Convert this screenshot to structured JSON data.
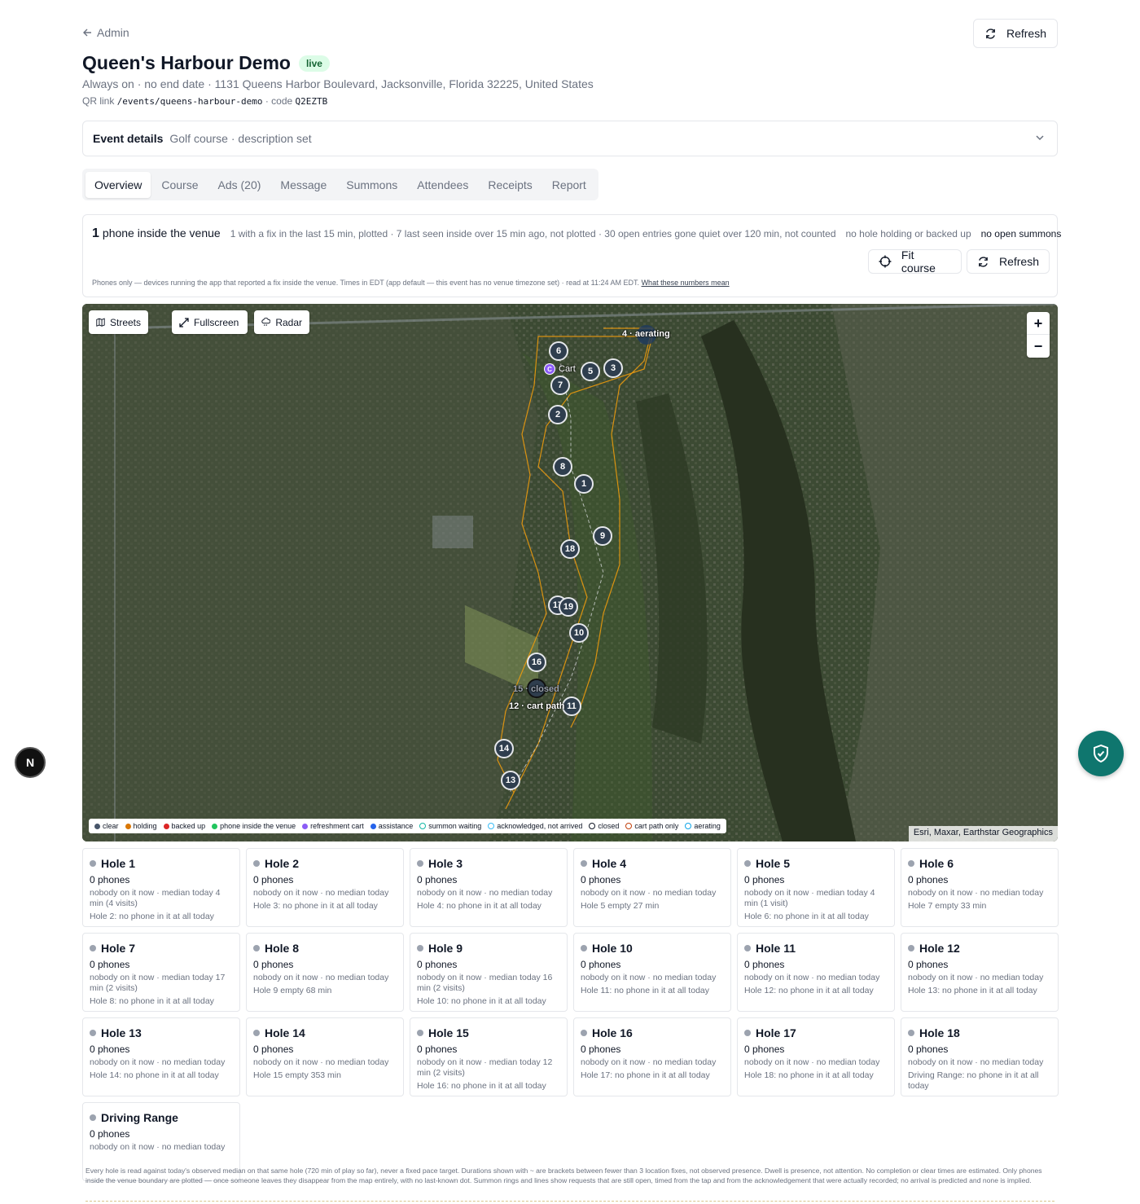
{
  "header": {
    "back_label": "Admin",
    "refresh_label": "Refresh",
    "title": "Queen's Harbour Demo",
    "live_badge": "live",
    "subline": "Always on · no end date · 1131 Queens Harbor Boulevard, Jacksonville, Florida 32225, United States",
    "qr_label": "QR link",
    "qr_path": "/events/queens-harbour-demo",
    "code_label": "· code",
    "code": "Q2EZTB"
  },
  "event_details": {
    "label": "Event details",
    "summary": "Golf course · description set"
  },
  "tabs": [
    {
      "label": "Overview",
      "active": true
    },
    {
      "label": "Course"
    },
    {
      "label": "Ads (20)"
    },
    {
      "label": "Message"
    },
    {
      "label": "Summons"
    },
    {
      "label": "Attendees"
    },
    {
      "label": "Receipts"
    },
    {
      "label": "Report"
    }
  ],
  "summary": {
    "count": "1",
    "count_label": "phone inside the venue",
    "detail": "1 with a fix in the last 15 min, plotted · 7 last seen inside over 15 min ago, not plotted · 30 open entries gone quiet over 120 min, not counted",
    "holding": "no hole holding or backed up",
    "summons": "no open summons",
    "fit_label": "Fit course",
    "refresh_label": "Refresh",
    "note": "Phones only — devices running the app that reported a fix inside the venue. Times in EDT (app default — this event has no venue timezone set) · read at 11:24 AM EDT.",
    "note_link": "What these numbers mean"
  },
  "map": {
    "streets_label": "Streets",
    "fullscreen_label": "Fullscreen",
    "radar_label": "Radar",
    "zoom_in": "+",
    "zoom_out": "−",
    "attribution": "Esri, Maxar, Earthstar Geographics",
    "labels": {
      "aerating": "4 · aerating",
      "cart": "Cart",
      "closed": "15 · closed",
      "cart_path": "12 · cart path"
    },
    "markers": [
      "6",
      "5",
      "3",
      "7",
      "2",
      "8",
      "1",
      "9",
      "18",
      "17",
      "19",
      "10",
      "16",
      "11",
      "14",
      "13"
    ],
    "cart_marker": "C",
    "legend": [
      {
        "label": "clear",
        "color": "#475569",
        "kind": "dot"
      },
      {
        "label": "holding",
        "color": "#d97706",
        "kind": "dot"
      },
      {
        "label": "backed up",
        "color": "#dc2626",
        "kind": "dot"
      },
      {
        "label": "phone inside the venue",
        "color": "#22c55e",
        "kind": "dot"
      },
      {
        "label": "refreshment cart",
        "color": "#8b5cf6",
        "kind": "dot"
      },
      {
        "label": "assistance",
        "color": "#2563eb",
        "kind": "dot"
      },
      {
        "label": "summon waiting",
        "color": "#14b8a6",
        "kind": "ring"
      },
      {
        "label": "acknowledged, not arrived",
        "color": "#38bdf8",
        "kind": "ring"
      },
      {
        "label": "closed",
        "color": "#111827",
        "kind": "ring"
      },
      {
        "label": "cart path only",
        "color": "#c2410c",
        "kind": "ring"
      },
      {
        "label": "aerating",
        "color": "#0ea5e9",
        "kind": "ring"
      }
    ]
  },
  "holes": [
    {
      "name": "Hole 1",
      "phones": "0 phones",
      "info": "nobody on it now · median today 4 min (4 visits)",
      "next": "Hole 2: no phone in it at all today"
    },
    {
      "name": "Hole 2",
      "phones": "0 phones",
      "info": "nobody on it now · no median today",
      "next": "Hole 3: no phone in it at all today"
    },
    {
      "name": "Hole 3",
      "phones": "0 phones",
      "info": "nobody on it now · no median today",
      "next": "Hole 4: no phone in it at all today"
    },
    {
      "name": "Hole 4",
      "phones": "0 phones",
      "info": "nobody on it now · no median today",
      "next": "Hole 5 empty 27 min"
    },
    {
      "name": "Hole 5",
      "phones": "0 phones",
      "info": "nobody on it now · median today 4 min (1 visit)",
      "next": "Hole 6: no phone in it at all today"
    },
    {
      "name": "Hole 6",
      "phones": "0 phones",
      "info": "nobody on it now · no median today",
      "next": "Hole 7 empty 33 min"
    },
    {
      "name": "Hole 7",
      "phones": "0 phones",
      "info": "nobody on it now · median today 17 min (2 visits)",
      "next": "Hole 8: no phone in it at all today"
    },
    {
      "name": "Hole 8",
      "phones": "0 phones",
      "info": "nobody on it now · no median today",
      "next": "Hole 9 empty 68 min"
    },
    {
      "name": "Hole 9",
      "phones": "0 phones",
      "info": "nobody on it now · median today 16 min (2 visits)",
      "next": "Hole 10: no phone in it at all today"
    },
    {
      "name": "Hole 10",
      "phones": "0 phones",
      "info": "nobody on it now · no median today",
      "next": "Hole 11: no phone in it at all today"
    },
    {
      "name": "Hole 11",
      "phones": "0 phones",
      "info": "nobody on it now · no median today",
      "next": "Hole 12: no phone in it at all today"
    },
    {
      "name": "Hole 12",
      "phones": "0 phones",
      "info": "nobody on it now · no median today",
      "next": "Hole 13: no phone in it at all today"
    },
    {
      "name": "Hole 13",
      "phones": "0 phones",
      "info": "nobody on it now · no median today",
      "next": "Hole 14: no phone in it at all today"
    },
    {
      "name": "Hole 14",
      "phones": "0 phones",
      "info": "nobody on it now · no median today",
      "next": "Hole 15 empty 353 min"
    },
    {
      "name": "Hole 15",
      "phones": "0 phones",
      "info": "nobody on it now · median today 12 min (2 visits)",
      "next": "Hole 16: no phone in it at all today"
    },
    {
      "name": "Hole 16",
      "phones": "0 phones",
      "info": "nobody on it now · no median today",
      "next": "Hole 17: no phone in it at all today"
    },
    {
      "name": "Hole 17",
      "phones": "0 phones",
      "info": "nobody on it now · no median today",
      "next": "Hole 18: no phone in it at all today"
    },
    {
      "name": "Hole 18",
      "phones": "0 phones",
      "info": "nobody on it now · no median today",
      "next": "Driving Range: no phone in it at all today"
    },
    {
      "name": "Driving Range",
      "phones": "0 phones",
      "info": "nobody on it now · no median today",
      "next": ""
    }
  ],
  "footer_note": "Every hole is read against today's observed median on that same hole (720 min of play so far), never a fixed pace target. Durations shown with ~ are brackets between fewer than 3 location fixes, not observed presence. Dwell is presence, not attention. No completion or clear times are estimated. Only phones inside the venue boundary are plotted — once someone leaves they disappear from the map entirely, with no last-known dot. Summon rings and lines show requests that are still open, timed from the tap and from the acknowledgement that were actually recorded; no arrival is predicted and none is implied.",
  "floating": {
    "n_badge": "N"
  }
}
